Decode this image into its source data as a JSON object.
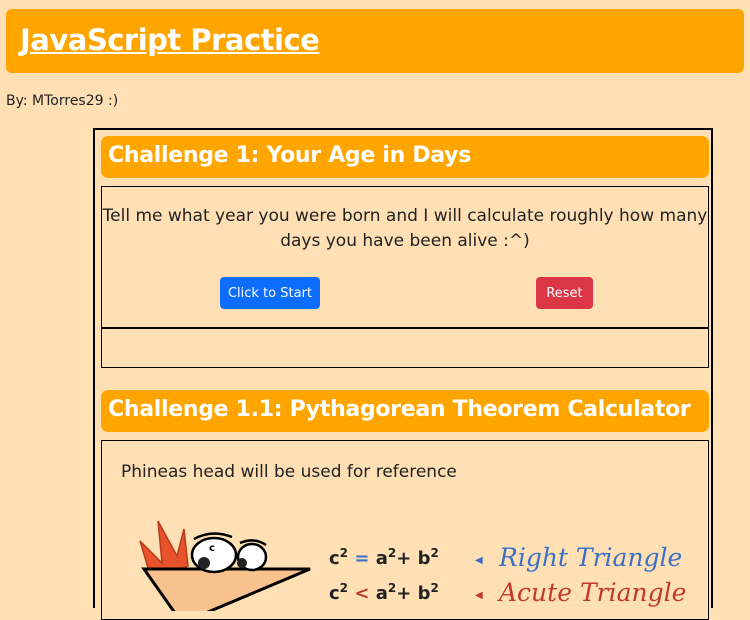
{
  "header": {
    "title": "JavaScript Practice"
  },
  "byline": "By: MTorres29 :)",
  "challenge1": {
    "title": "Challenge 1: Your Age in Days",
    "description": "Tell me what year you were born and I will calculate roughly how many days you have been alive :^)",
    "start_label": "Click to Start",
    "reset_label": "Reset"
  },
  "challenge1_1": {
    "title": "Challenge 1.1: Pythagorean Theorem Calculator",
    "reference_text": "Phineas head will be used for reference",
    "equations": [
      {
        "lhs": "c",
        "op": "=",
        "rhs_a": "a",
        "rhs_b": "b",
        "label": "Right Triangle"
      },
      {
        "lhs": "c",
        "op": "<",
        "rhs_a": "a",
        "rhs_b": "b",
        "label": "Acute Triangle"
      }
    ]
  },
  "colors": {
    "background": "#ffe0b5",
    "accent": "#ffa500",
    "primary_button": "#0d6efd",
    "danger_button": "#dc3545",
    "right_label": "#3d6fc4",
    "acute_label": "#c0392b"
  }
}
